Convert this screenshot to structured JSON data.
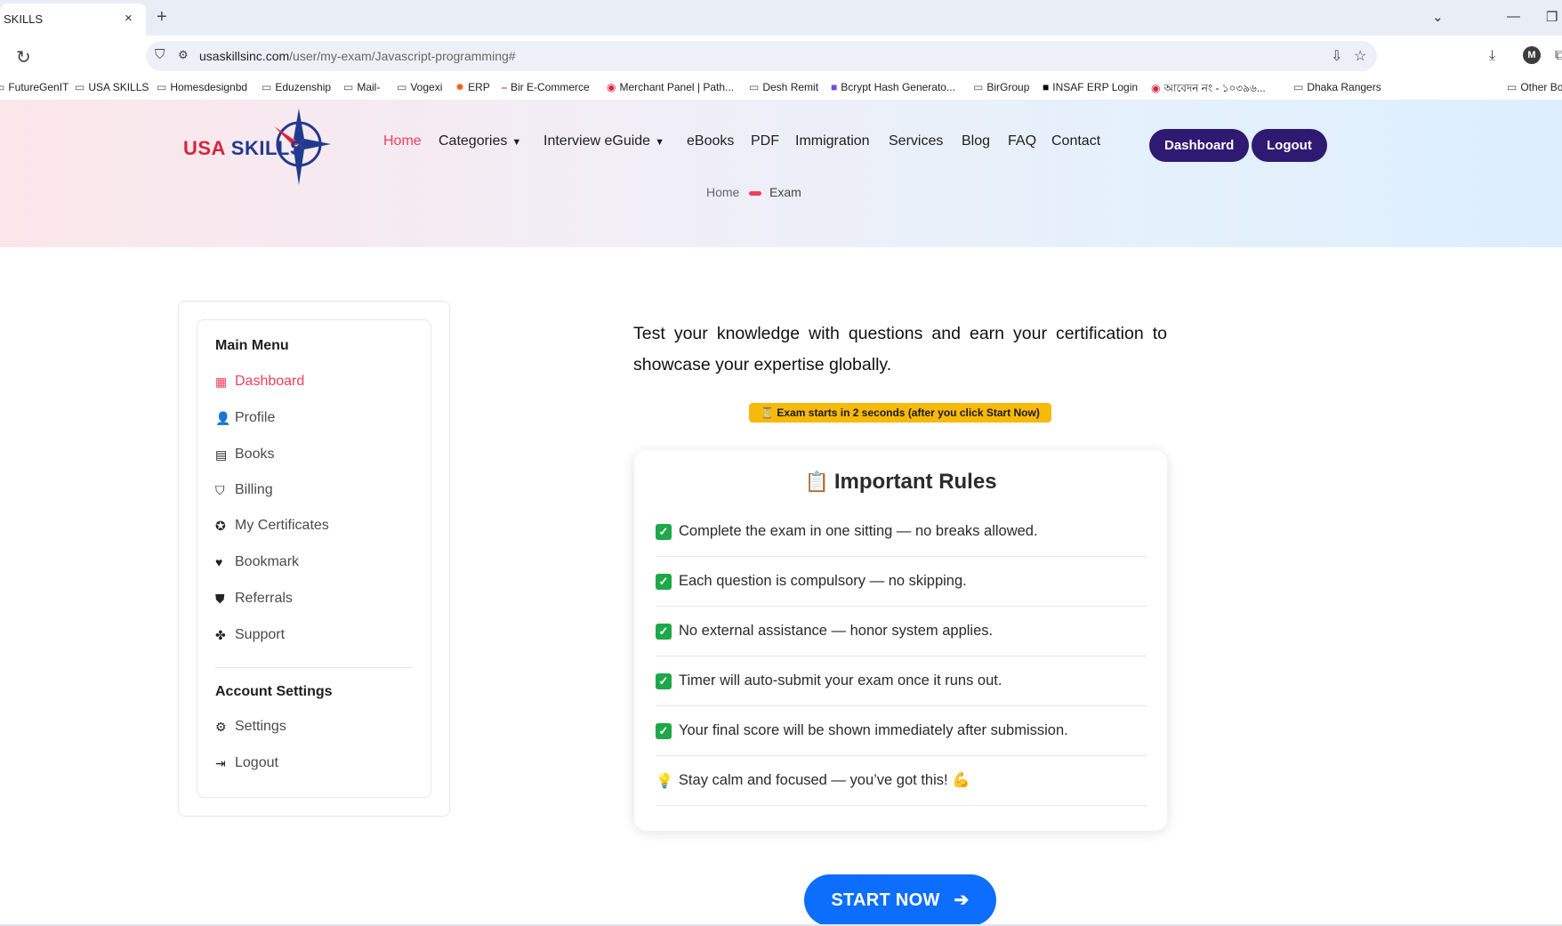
{
  "browser": {
    "tab_title": "SKILLS",
    "tab_close": "×",
    "new_tab": "+",
    "url_host": "usaskillsinc.com",
    "url_path": "/user/my-exam/Javascript-programming#",
    "bookmarks": [
      "FutureGenIT",
      "USA SKILLS",
      "Homesdesignbd",
      "Eduzenship",
      "Mail-",
      "Vogexi",
      "ERP",
      "Bir E-Commerce",
      "Merchant Panel | Path...",
      "Desh Remit",
      "Bcrypt Hash Generato...",
      "BirGroup",
      "INSAF ERP Login",
      "আবেদন নং - ১০৩৯৬...",
      "Dhaka Rangers",
      "Other Bo"
    ]
  },
  "header": {
    "logo_usa": "USA",
    "logo_skills": "SKILLS",
    "nav": {
      "home": "Home",
      "categories": "Categories",
      "interview": "Interview eGuide",
      "ebooks": "eBooks",
      "pdf": "PDF",
      "immigration": "Immigration",
      "services": "Services",
      "blog": "Blog",
      "faq": "FAQ",
      "contact": "Contact"
    },
    "dashboard_btn": "Dashboard",
    "logout_btn": "Logout",
    "breadcrumb_home": "Home",
    "breadcrumb_current": "Exam",
    "active_color": "#ee3e5c",
    "button_color": "#2e1a72"
  },
  "sidebar": {
    "main_menu_title": "Main Menu",
    "items": {
      "dashboard": "Dashboard",
      "profile": "Profile",
      "books": "Books",
      "billing": "Billing",
      "certificates": "My Certificates",
      "bookmark": "Bookmark",
      "referrals": "Referrals",
      "support": "Support"
    },
    "account_title": "Account Settings",
    "settings": "Settings",
    "logout": "Logout"
  },
  "main": {
    "intro": "Test your knowledge with questions and earn your certification to showcase your expertise globally.",
    "notice": "⏳ Exam starts in 2 seconds (after you click Start Now)",
    "rules_title": "Important Rules",
    "rules": [
      "Complete the exam in one sitting — no breaks allowed.",
      "Each question is compulsory — no skipping.",
      "No external assistance — honor system applies.",
      "Timer will auto-submit your exam once it runs out.",
      "Your final score will be shown immediately after submission."
    ],
    "tip": "Stay calm and focused — you’ve got this! 💪",
    "start_button": "START NOW",
    "start_color": "#0d6efd"
  }
}
